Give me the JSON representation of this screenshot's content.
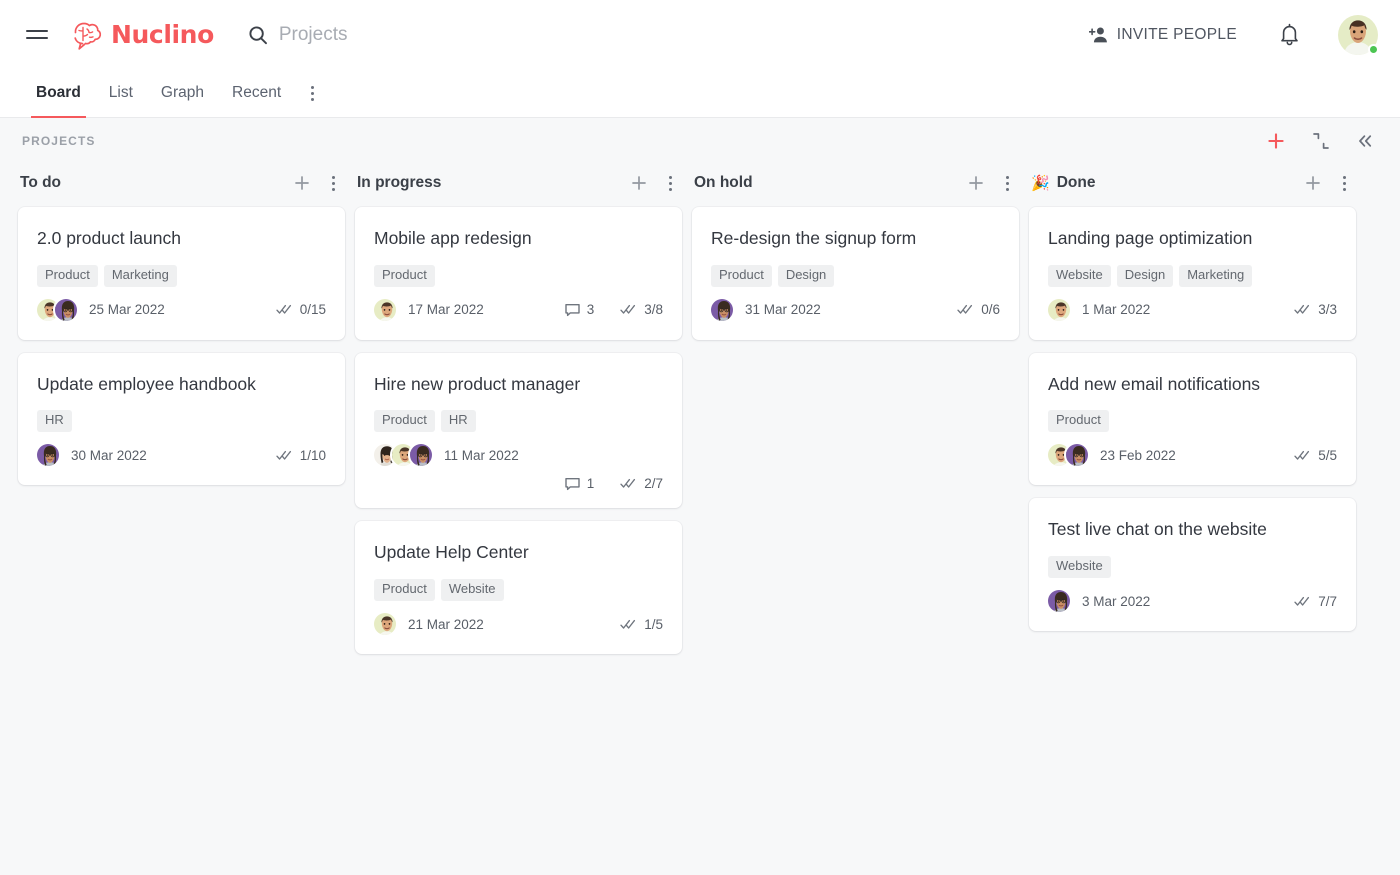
{
  "header": {
    "menu_icon": "hamburger-menu-icon",
    "logo_text": "Nuclino",
    "logo_icon": "nuclino-brain-logo",
    "search_placeholder": "Projects",
    "search_icon": "search-icon",
    "invite_label": "INVITE PEOPLE",
    "invite_icon": "person-add-icon",
    "notifications_icon": "bell-icon",
    "avatar": "user-avatar",
    "status": "online",
    "status_color": "#4cc552"
  },
  "tabs": [
    {
      "label": "Board",
      "active": true
    },
    {
      "label": "List",
      "active": false
    },
    {
      "label": "Graph",
      "active": false
    },
    {
      "label": "Recent",
      "active": false
    }
  ],
  "tabs_more_icon": "more-vertical-icon",
  "board": {
    "title": "PROJECTS",
    "accent_color": "#f5595c",
    "background": "#f7f8f9",
    "actions": [
      {
        "name": "add-item-button",
        "icon": "plus-icon",
        "color": "#f5595c"
      },
      {
        "name": "collapse-all-button",
        "icon": "collapse-inward-icon",
        "color": "#6b717c"
      },
      {
        "name": "collapse-sidebar-button",
        "icon": "double-chevron-left-icon",
        "color": "#6b717c"
      }
    ]
  },
  "columns": [
    {
      "title": "To do",
      "emoji": "",
      "cards": [
        {
          "title": "2.0 product launch",
          "tags": [
            "Product",
            "Marketing"
          ],
          "avatars": [
            "cream",
            "purple"
          ],
          "date": "25 Mar 2022",
          "comments": null,
          "tasks": "0/15",
          "wrap": false
        },
        {
          "title": "Update employee handbook",
          "tags": [
            "HR"
          ],
          "avatars": [
            "purple"
          ],
          "date": "30 Mar 2022",
          "comments": null,
          "tasks": "1/10",
          "wrap": false
        }
      ]
    },
    {
      "title": "In progress",
      "emoji": "",
      "cards": [
        {
          "title": "Mobile app redesign",
          "tags": [
            "Product"
          ],
          "avatars": [
            "cream"
          ],
          "date": "17 Mar 2022",
          "comments": "3",
          "tasks": "3/8",
          "wrap": false
        },
        {
          "title": "Hire new product manager",
          "tags": [
            "Product",
            "HR"
          ],
          "avatars": [
            "white",
            "cream",
            "purple"
          ],
          "date": "11 Mar 2022",
          "comments": "1",
          "tasks": "2/7",
          "wrap": true
        },
        {
          "title": "Update Help Center",
          "tags": [
            "Product",
            "Website"
          ],
          "avatars": [
            "cream"
          ],
          "date": "21 Mar 2022",
          "comments": null,
          "tasks": "1/5",
          "wrap": false
        }
      ]
    },
    {
      "title": "On hold",
      "emoji": "",
      "cards": [
        {
          "title": "Re-design the signup form",
          "tags": [
            "Product",
            "Design"
          ],
          "avatars": [
            "purple"
          ],
          "date": "31 Mar 2022",
          "comments": null,
          "tasks": "0/6",
          "wrap": false
        }
      ]
    },
    {
      "title": "Done",
      "emoji": "🎉",
      "cards": [
        {
          "title": "Landing page optimization",
          "tags": [
            "Website",
            "Design",
            "Marketing"
          ],
          "avatars": [
            "cream"
          ],
          "date": "1 Mar 2022",
          "comments": null,
          "tasks": "3/3",
          "wrap": false
        },
        {
          "title": "Add new email notifications",
          "tags": [
            "Product"
          ],
          "avatars": [
            "cream",
            "purple"
          ],
          "date": "23 Feb 2022",
          "comments": null,
          "tasks": "5/5",
          "wrap": false
        },
        {
          "title": "Test live chat on the website",
          "tags": [
            "Website"
          ],
          "avatars": [
            "purple"
          ],
          "date": "3 Mar 2022",
          "comments": null,
          "tasks": "7/7",
          "wrap": false
        }
      ]
    }
  ],
  "column_controls": {
    "add_icon": "plus-icon",
    "menu_icon": "more-vertical-icon"
  },
  "card_icons": {
    "comment_icon": "comment-bubble-icon",
    "tasks_icon": "double-check-icon"
  }
}
